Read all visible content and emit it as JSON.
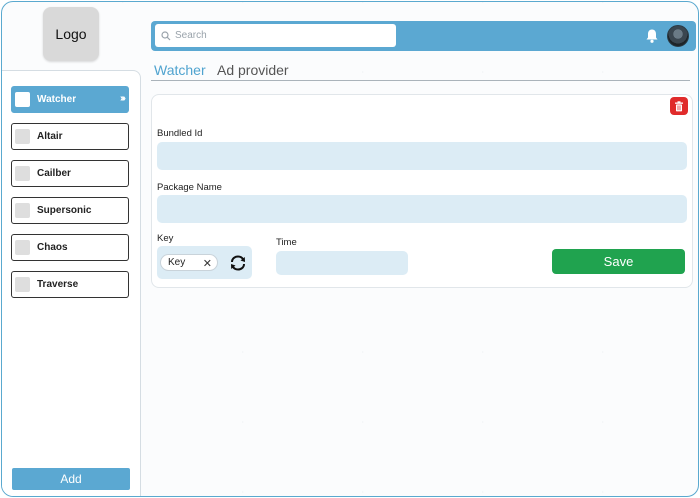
{
  "logo": {
    "text": "Logo"
  },
  "sidebar": {
    "items": [
      {
        "label": "Watcher"
      },
      {
        "label": "Altair"
      },
      {
        "label": "Cailber"
      },
      {
        "label": "Supersonic"
      },
      {
        "label": "Chaos"
      },
      {
        "label": "Traverse"
      }
    ],
    "active_item": "Watcher",
    "add_label": "Add"
  },
  "header": {
    "search_placeholder": "Search",
    "icons": [
      "search-icon",
      "bell-icon",
      "avatar"
    ]
  },
  "tabs": [
    {
      "label": "Watcher",
      "active": true
    },
    {
      "label": "Ad provider",
      "active": false
    }
  ],
  "form": {
    "bundled_id_label": "Bundled Id",
    "bundled_id_value": "",
    "package_name_label": "Package Name",
    "package_name_value": "",
    "key_label": "Key",
    "key_chip": "Key",
    "time_label": "Time",
    "time_value": "",
    "save_label": "Save"
  },
  "colors": {
    "accent": "#5ba8d2",
    "field_bg": "#dcecf5",
    "save": "#20a34f",
    "delete": "#e02b2b"
  }
}
